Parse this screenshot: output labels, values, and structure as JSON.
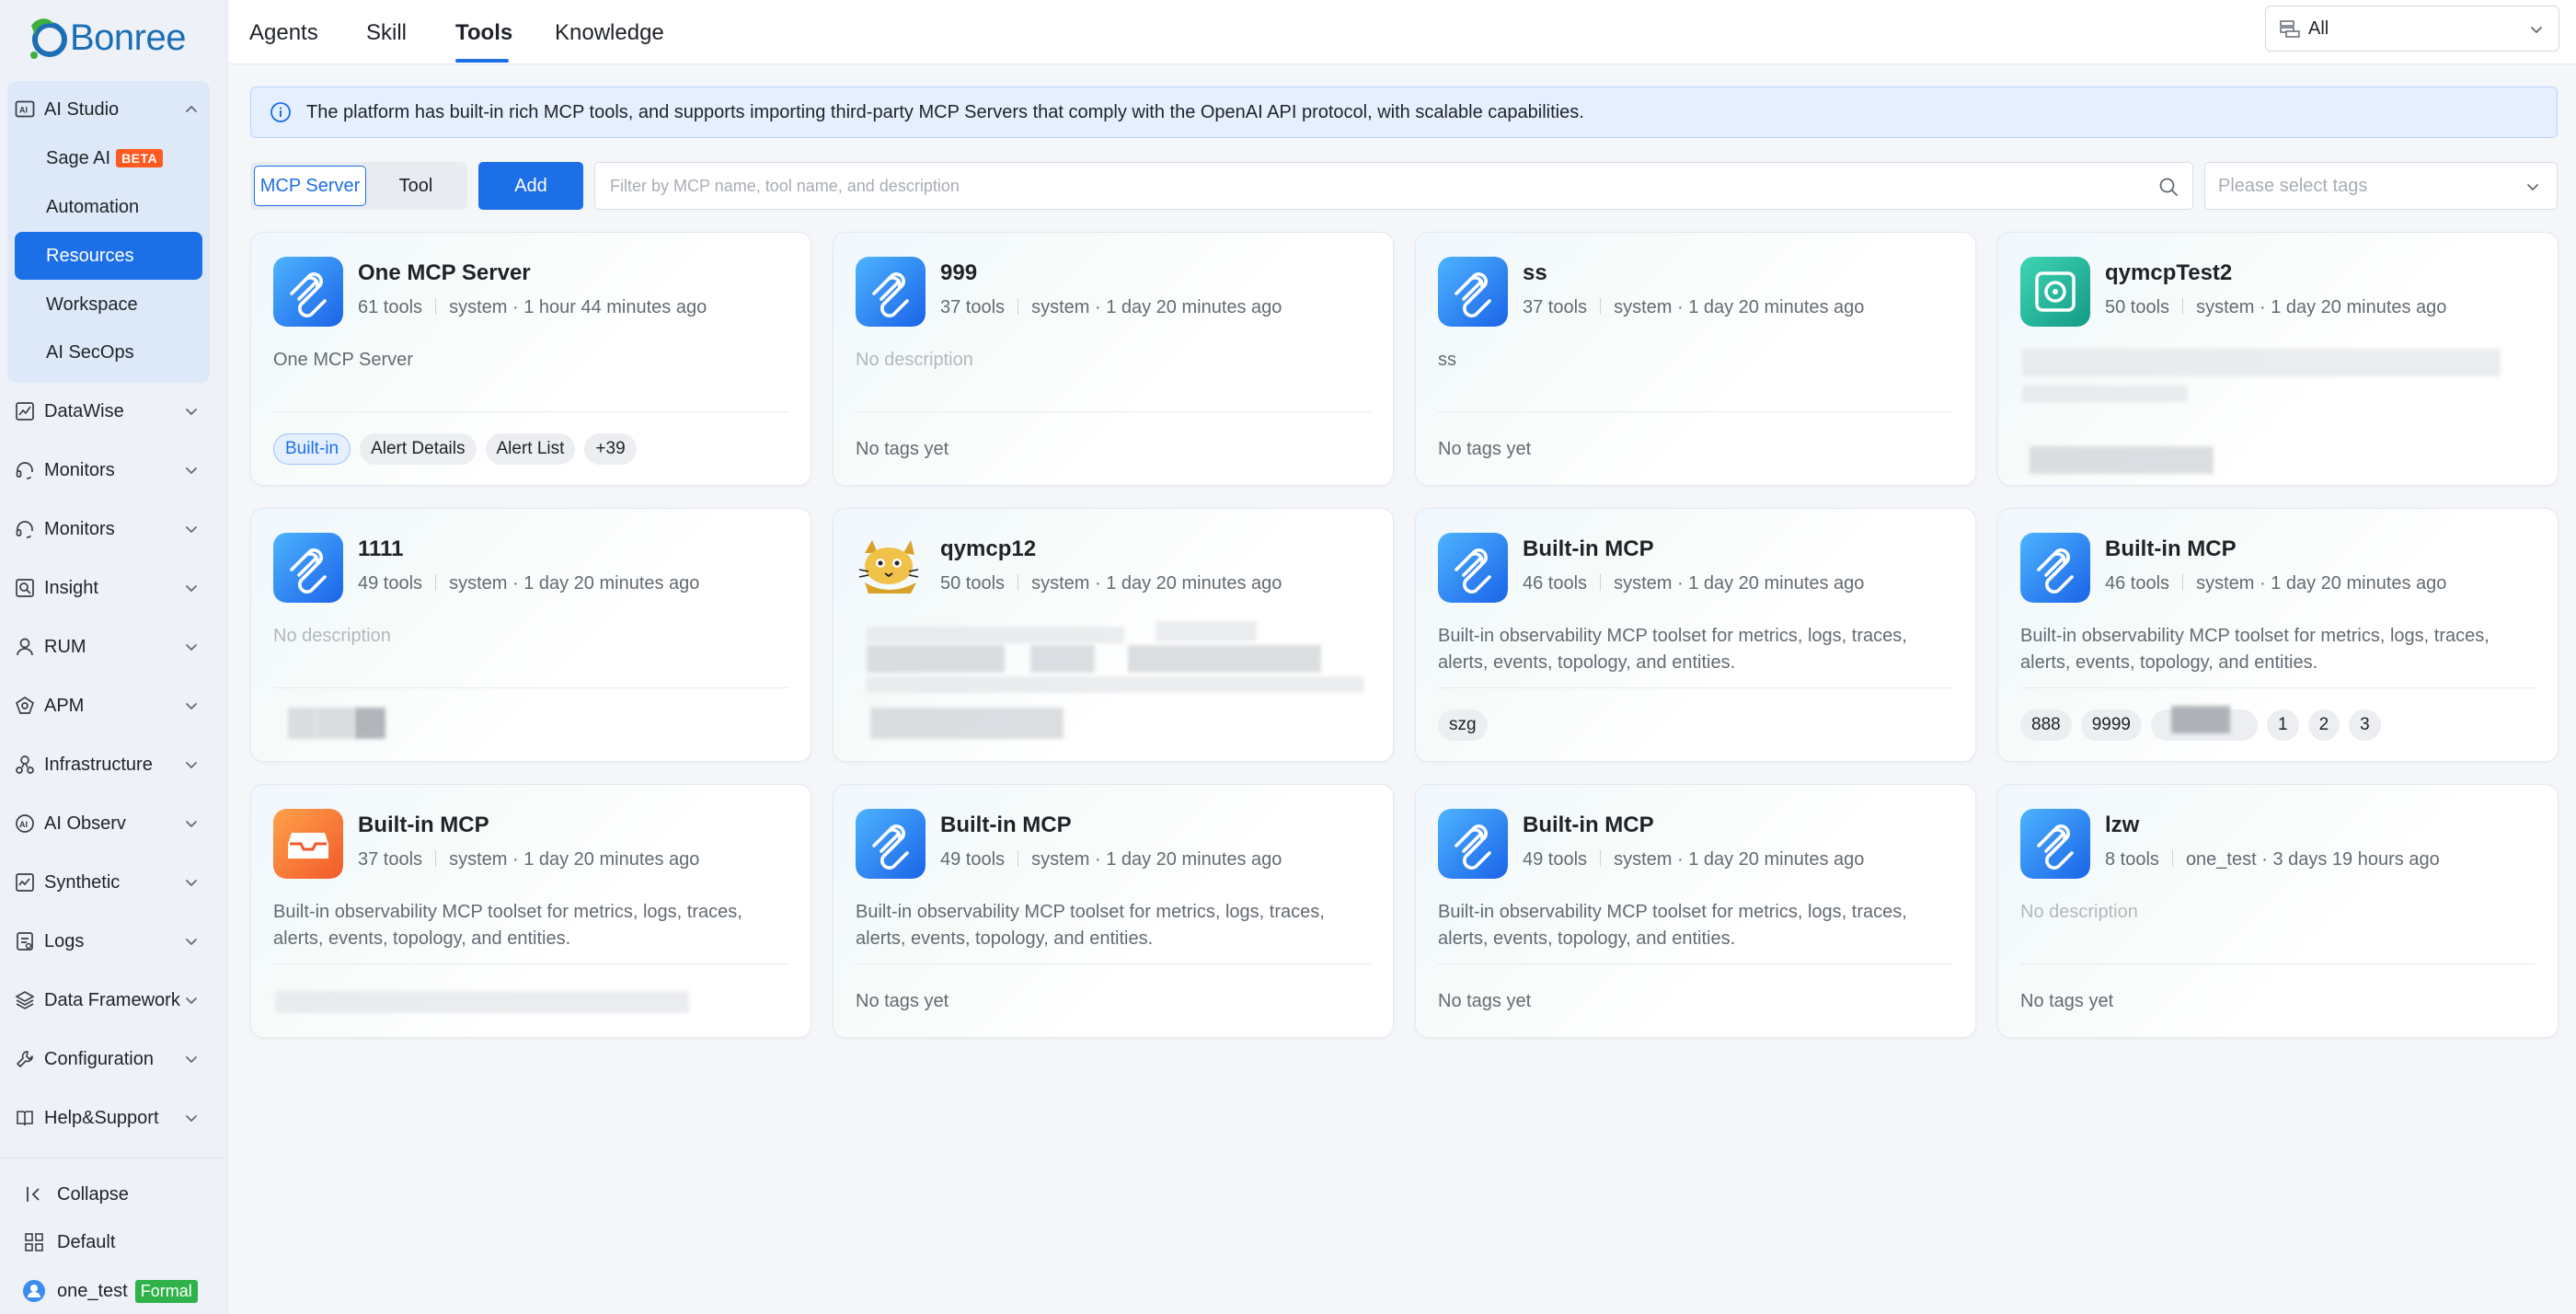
{
  "brand": {
    "name": "Bonree"
  },
  "sidebar": {
    "studio": {
      "label": "AI Studio",
      "items": [
        {
          "label": "Sage AI",
          "badge": "BETA"
        },
        {
          "label": "Automation"
        },
        {
          "label": "Resources",
          "active": true
        },
        {
          "label": "Workspace"
        },
        {
          "label": "AI SecOps"
        }
      ]
    },
    "groups": [
      {
        "label": "DataWise",
        "icon": "chart-icon"
      },
      {
        "label": "Monitors",
        "icon": "headset-icon"
      },
      {
        "label": "Monitors",
        "icon": "headset-icon"
      },
      {
        "label": "Insight",
        "icon": "magnifier-icon"
      },
      {
        "label": "RUM",
        "icon": "user-icon"
      },
      {
        "label": "APM",
        "icon": "apm-icon"
      },
      {
        "label": "Infrastructure",
        "icon": "server-icon"
      },
      {
        "label": "AI Observ",
        "icon": "ai-icon"
      },
      {
        "label": "Synthetic",
        "icon": "synthetic-icon"
      },
      {
        "label": "Logs",
        "icon": "logs-icon"
      },
      {
        "label": "Data Framework",
        "icon": "database-icon"
      },
      {
        "label": "Configuration",
        "icon": "wrench-icon"
      },
      {
        "label": "Help&Support",
        "icon": "book-icon"
      }
    ],
    "collapse": "Collapse",
    "workspace": "Default",
    "user": {
      "name": "one_test",
      "plan": "Formal"
    }
  },
  "topbar": {
    "tabs": [
      {
        "label": "Agents"
      },
      {
        "label": "Skill"
      },
      {
        "label": "Tools",
        "active": true
      },
      {
        "label": "Knowledge"
      }
    ],
    "scope_select": "All"
  },
  "banner": {
    "text": "The platform has built-in rich MCP tools, and supports importing third-party MCP Servers that comply with the OpenAI API protocol, with scalable capabilities."
  },
  "toolbar": {
    "segments": [
      "MCP Server",
      "Tool"
    ],
    "active_segment": "MCP Server",
    "add_label": "Add",
    "search_placeholder": "Filter by MCP name, tool name, and description",
    "tags_placeholder": "Please select tags"
  },
  "cards": [
    {
      "title": "One MCP Server",
      "tools": "61 tools",
      "owner": "system",
      "time": "1 hour 44 minutes ago",
      "description": "One MCP Server",
      "tags": [
        "Built-in",
        "Alert Details",
        "Alert List",
        "+39"
      ],
      "icon": "mcp-icon"
    },
    {
      "title": "999",
      "tools": "37 tools",
      "owner": "system",
      "time": "1 day 20 minutes ago",
      "description": "No description",
      "tags_empty": "No tags yet",
      "icon": "mcp-icon"
    },
    {
      "title": "ss",
      "tools": "37 tools",
      "owner": "system",
      "time": "1 day 20 minutes ago",
      "description": "ss",
      "tags_empty": "No tags yet",
      "icon": "mcp-icon"
    },
    {
      "title": "qymcpTest2",
      "tools": "50 tools",
      "owner": "system",
      "time": "1 day 20 minutes ago",
      "icon": "target-icon"
    },
    {
      "title": "1111",
      "tools": "49 tools",
      "owner": "system",
      "time": "1 day 20 minutes ago",
      "description": "No description",
      "icon": "mcp-icon"
    },
    {
      "title": "qymcp12",
      "tools": "50 tools",
      "owner": "system",
      "time": "1 day 20 minutes ago",
      "icon": "tomcat-icon"
    },
    {
      "title": "Built-in MCP",
      "tools": "46 tools",
      "owner": "system",
      "time": "1 day 20 minutes ago",
      "description": "Built-in observability MCP toolset for metrics, logs, traces, alerts, events, topology, and entities.",
      "tags": [
        "szg"
      ],
      "icon": "mcp-icon"
    },
    {
      "title": "Built-in MCP",
      "tools": "46 tools",
      "owner": "system",
      "time": "1 day 20 minutes ago",
      "description": "Built-in observability MCP toolset for metrics, logs, traces, alerts, events, topology, and entities.",
      "tags": [
        "888",
        "9999",
        "1",
        "2",
        "3"
      ],
      "icon": "mcp-icon"
    },
    {
      "title": "Built-in MCP",
      "tools": "37 tools",
      "owner": "system",
      "time": "1 day 20 minutes ago",
      "description": "Built-in observability MCP toolset for metrics, logs, traces, alerts, events, topology, and entities.",
      "icon": "inbox-icon"
    },
    {
      "title": "Built-in MCP",
      "tools": "49 tools",
      "owner": "system",
      "time": "1 day 20 minutes ago",
      "description": "Built-in observability MCP toolset for metrics, logs, traces, alerts, events, topology, and entities.",
      "tags_empty": "No tags yet",
      "icon": "mcp-icon"
    },
    {
      "title": "Built-in MCP",
      "tools": "49 tools",
      "owner": "system",
      "time": "1 day 20 minutes ago",
      "description": "Built-in observability MCP toolset for metrics, logs, traces, alerts, events, topology, and entities.",
      "tags_empty": "No tags yet",
      "icon": "mcp-icon"
    },
    {
      "title": "lzw",
      "tools": "8 tools",
      "owner": "one_test",
      "time": "3 days 19 hours ago",
      "description": "No description",
      "tags_empty": "No tags yet",
      "icon": "mcp-icon"
    }
  ],
  "colors": {
    "accent": "#1d6fe8",
    "beta": "#ff5a1f",
    "formal": "#2fb24a",
    "banner_bg": "#e5efff"
  }
}
